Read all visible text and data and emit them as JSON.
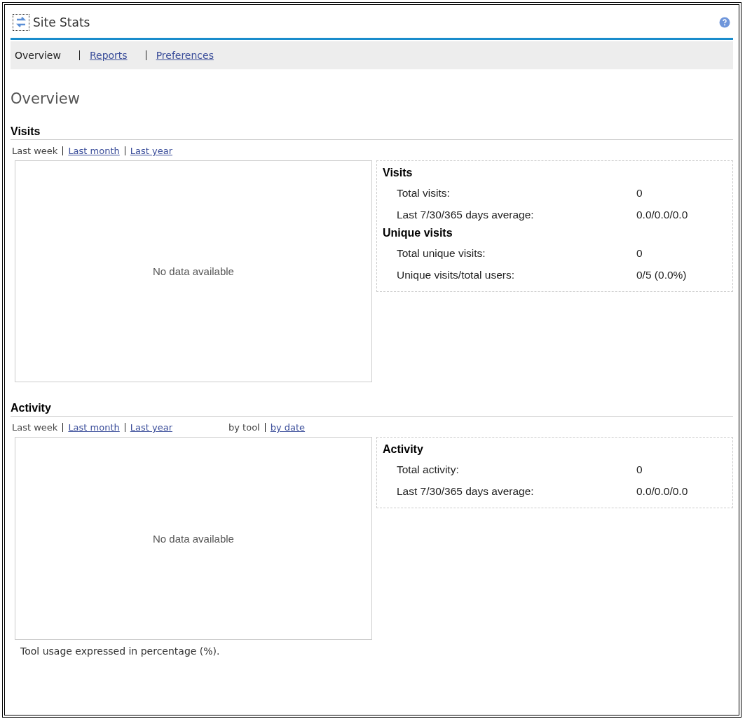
{
  "window": {
    "title": "Site Stats"
  },
  "nav": [
    {
      "label": "Overview",
      "selected": true
    },
    {
      "label": "Reports",
      "selected": false
    },
    {
      "label": "Preferences",
      "selected": false
    }
  ],
  "page_title": "Overview",
  "sections": [
    {
      "title": "Visits",
      "periods": [
        {
          "label": "Last week",
          "selected": true
        },
        {
          "label": "Last month",
          "selected": false
        },
        {
          "label": "Last year",
          "selected": false
        }
      ],
      "chart_message": "No data available",
      "stats": [
        {
          "heading": "Visits",
          "rows": [
            {
              "label": "Total visits:",
              "value": "0"
            },
            {
              "label": "Last 7/30/365 days average:",
              "value": "0.0/0.0/0.0"
            }
          ]
        },
        {
          "heading": "Unique visits",
          "rows": [
            {
              "label": "Total unique visits:",
              "value": "0"
            },
            {
              "label": "Unique visits/total users:",
              "value": "0/5 (0.0%)"
            }
          ]
        }
      ]
    },
    {
      "title": "Activity",
      "periods": [
        {
          "label": "Last week",
          "selected": true
        },
        {
          "label": "Last month",
          "selected": false
        },
        {
          "label": "Last year",
          "selected": false
        }
      ],
      "views": [
        {
          "label": "by tool",
          "selected": true
        },
        {
          "label": "by date",
          "selected": false
        }
      ],
      "chart_message": "No data available",
      "stats": [
        {
          "heading": "Activity",
          "rows": [
            {
              "label": "Total activity:",
              "value": "0"
            },
            {
              "label": "Last 7/30/365 days average:",
              "value": "0.0/0.0/0.0"
            }
          ]
        }
      ],
      "note": "Tool usage expressed in percentage (%)."
    }
  ]
}
